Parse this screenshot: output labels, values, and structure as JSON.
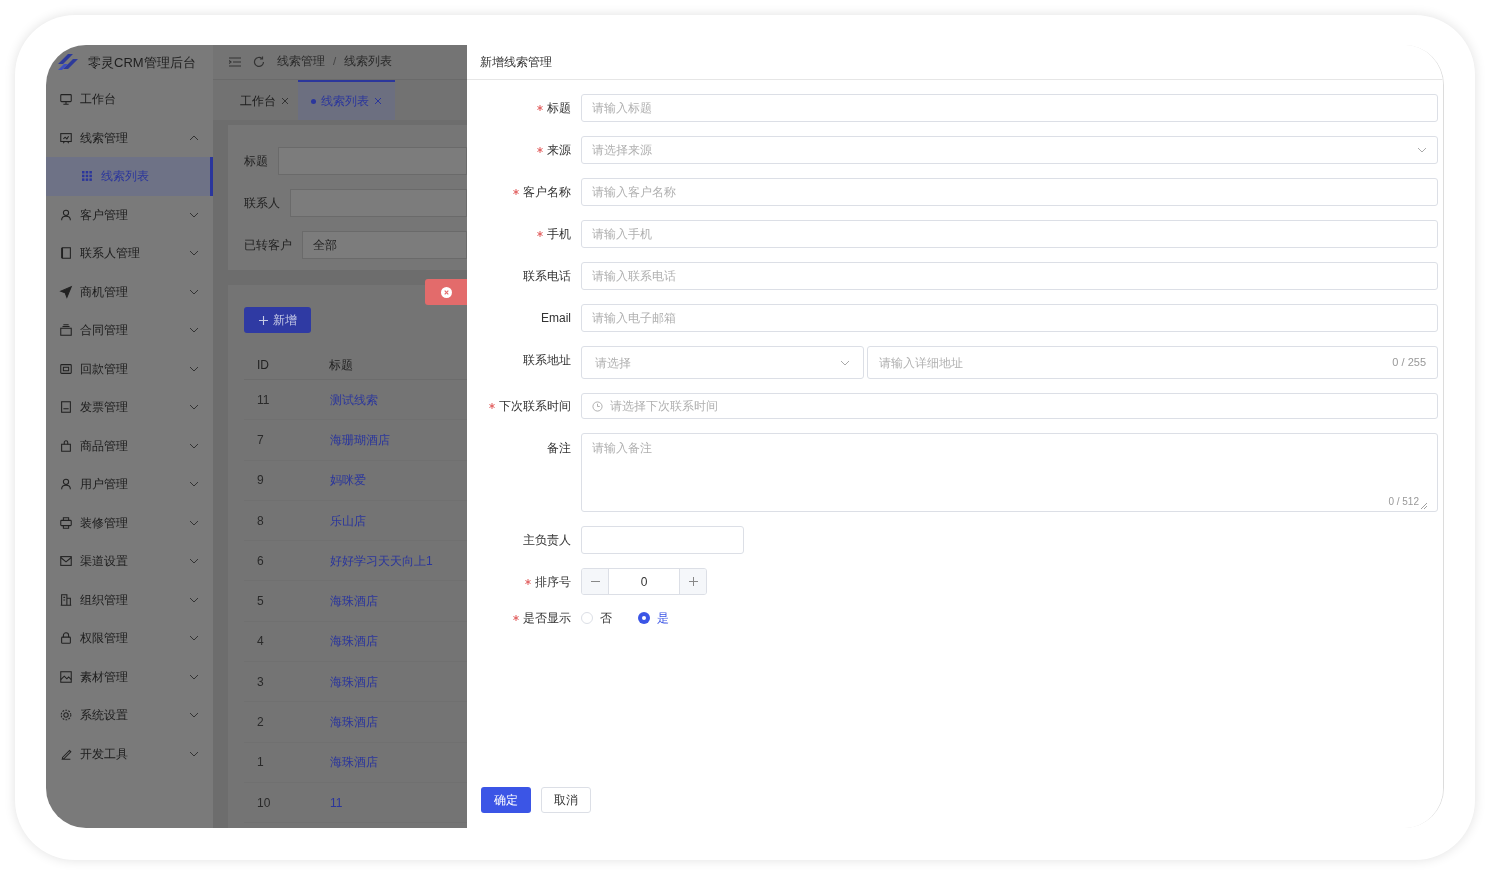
{
  "app": {
    "title": "零灵CRM管理后台"
  },
  "sidebar": {
    "items": [
      {
        "label": "工作台",
        "kind": "link",
        "selected": false
      },
      {
        "label": "线索管理",
        "kind": "group",
        "expanded": true,
        "selected": false,
        "children": [
          {
            "label": "线索列表",
            "selected": true
          }
        ]
      },
      {
        "label": "客户管理",
        "kind": "group",
        "expanded": false,
        "selected": false
      },
      {
        "label": "联系人管理",
        "kind": "group",
        "expanded": false,
        "selected": false
      },
      {
        "label": "商机管理",
        "kind": "group",
        "expanded": false,
        "selected": false
      },
      {
        "label": "合同管理",
        "kind": "group",
        "expanded": false,
        "selected": false
      },
      {
        "label": "回款管理",
        "kind": "group",
        "expanded": false,
        "selected": false
      },
      {
        "label": "发票管理",
        "kind": "group",
        "expanded": false,
        "selected": false
      },
      {
        "label": "商品管理",
        "kind": "group",
        "expanded": false,
        "selected": false
      },
      {
        "label": "用户管理",
        "kind": "group",
        "expanded": false,
        "selected": false
      },
      {
        "label": "装修管理",
        "kind": "group",
        "expanded": false,
        "selected": false
      },
      {
        "label": "渠道设置",
        "kind": "group",
        "expanded": false,
        "selected": false
      },
      {
        "label": "组织管理",
        "kind": "group",
        "expanded": false,
        "selected": false
      },
      {
        "label": "权限管理",
        "kind": "group",
        "expanded": false,
        "selected": false
      },
      {
        "label": "素材管理",
        "kind": "group",
        "expanded": false,
        "selected": false
      },
      {
        "label": "系统设置",
        "kind": "group",
        "expanded": false,
        "selected": false
      },
      {
        "label": "开发工具",
        "kind": "group",
        "expanded": false,
        "selected": false
      }
    ]
  },
  "breadcrumb": {
    "separator": "/",
    "items": [
      "线索管理",
      "线索列表"
    ]
  },
  "tabs": [
    {
      "label": "工作台",
      "selected": false
    },
    {
      "label": "线索列表",
      "selected": true
    }
  ],
  "filters": [
    {
      "label": "标题"
    },
    {
      "label": "联系人"
    },
    {
      "label": "已转客户",
      "value": "全部"
    }
  ],
  "add_button": {
    "label": "新增"
  },
  "table": {
    "columns": [
      "ID",
      "标题"
    ],
    "rows": [
      {
        "id": "11",
        "title": "测试线索"
      },
      {
        "id": "7",
        "title": "海珊瑚酒店"
      },
      {
        "id": "9",
        "title": "妈咪爱"
      },
      {
        "id": "8",
        "title": "乐山店"
      },
      {
        "id": "6",
        "title": "好好学习天天向上1"
      },
      {
        "id": "5",
        "title": "海珠酒店"
      },
      {
        "id": "4",
        "title": "海珠酒店"
      },
      {
        "id": "3",
        "title": "海珠酒店"
      },
      {
        "id": "2",
        "title": "海珠酒店"
      },
      {
        "id": "1",
        "title": "海珠酒店"
      },
      {
        "id": "10",
        "title": "11"
      }
    ]
  },
  "drawer": {
    "title": "新增线索管理",
    "fields": [
      {
        "kind": "input",
        "label": "标题",
        "required": true,
        "placeholder": "请输入标题"
      },
      {
        "kind": "select",
        "label": "来源",
        "required": true,
        "placeholder": "请选择来源"
      },
      {
        "kind": "input",
        "label": "客户名称",
        "required": true,
        "placeholder": "请输入客户名称"
      },
      {
        "kind": "input",
        "label": "手机",
        "required": true,
        "placeholder": "请输入手机"
      },
      {
        "kind": "input",
        "label": "联系电话",
        "required": false,
        "placeholder": "请输入联系电话"
      },
      {
        "kind": "input",
        "label": "Email",
        "required": false,
        "placeholder": "请输入电子邮箱"
      },
      {
        "kind": "address",
        "label": "联系地址",
        "required": false,
        "placeholder": "请选择",
        "detail_placeholder": "请输入详细地址",
        "counter": "0 / 255"
      },
      {
        "kind": "datetime",
        "label": "下次联系时间",
        "required": true,
        "placeholder": "请选择下次联系时间"
      },
      {
        "kind": "textarea",
        "label": "备注",
        "required": false,
        "placeholder": "请输入备注",
        "counter": "0 / 512"
      },
      {
        "kind": "short_input",
        "label": "主负责人",
        "required": false
      },
      {
        "kind": "number",
        "label": "排序号",
        "required": true,
        "value": "0"
      },
      {
        "kind": "radio",
        "label": "是否显示",
        "required": true,
        "options": [
          {
            "label": "否",
            "selected": false
          },
          {
            "label": "是",
            "selected": true
          }
        ]
      }
    ],
    "buttons": [
      {
        "label": "确定",
        "kind": "primary"
      },
      {
        "label": "取消",
        "kind": "default"
      }
    ]
  }
}
